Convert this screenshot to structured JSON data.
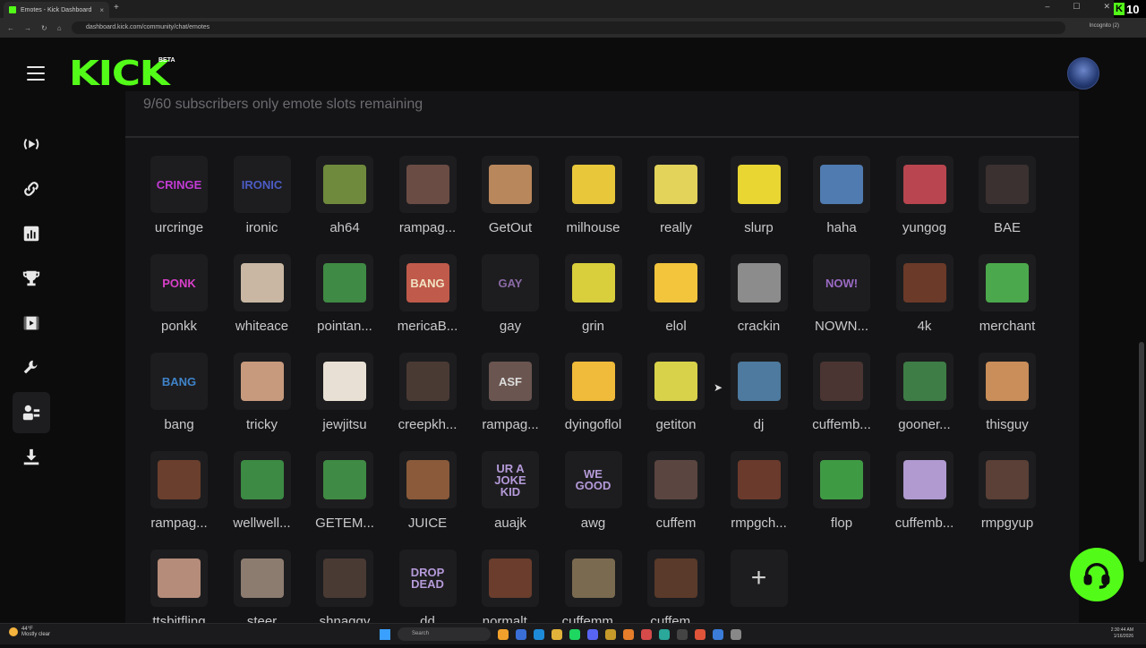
{
  "browser": {
    "tab_title": "Emotes - Kick Dashboard",
    "tab_close": "×",
    "new_tab": "+",
    "url": "dashboard.kick.com/community/chat/emotes",
    "incognito": "Incognito (2)",
    "window_controls": [
      "–",
      "☐",
      "✕"
    ],
    "overlay_badge": "10"
  },
  "header": {
    "logo": "KICK",
    "beta": "BETA"
  },
  "sidebar": {
    "items": [
      {
        "icon": "broadcast-icon"
      },
      {
        "icon": "link-icon"
      },
      {
        "icon": "analytics-icon"
      },
      {
        "icon": "trophy-icon"
      },
      {
        "icon": "video-icon"
      },
      {
        "icon": "wrench-icon"
      },
      {
        "icon": "community-icon",
        "active": true
      },
      {
        "icon": "download-icon"
      }
    ]
  },
  "panel": {
    "slots_text": "9/60 subscribers only emote slots remaining"
  },
  "emotes": [
    {
      "label": "urcringe",
      "text": "CRINGE",
      "bg": "#1d1d1f",
      "fg": "#c23bd4"
    },
    {
      "label": "ironic",
      "text": "IRONIC",
      "bg": "#1d1d1f",
      "fg": "#4c5cc4"
    },
    {
      "label": "ah64",
      "text": "",
      "bg": "#6f8a3c",
      "fg": "#fff"
    },
    {
      "label": "rampag...",
      "text": "",
      "bg": "#6b4c44",
      "fg": "#fff"
    },
    {
      "label": "GetOut",
      "text": "",
      "bg": "#b9875c",
      "fg": "#fff"
    },
    {
      "label": "milhouse",
      "text": "",
      "bg": "#e8c83a",
      "fg": "#333"
    },
    {
      "label": "really",
      "text": "",
      "bg": "#e3d35a",
      "fg": "#333"
    },
    {
      "label": "slurp",
      "text": "",
      "bg": "#e9d633",
      "fg": "#333"
    },
    {
      "label": "haha",
      "text": "",
      "bg": "#4f7bb0",
      "fg": "#fff"
    },
    {
      "label": "yungog",
      "text": "",
      "bg": "#b8454f",
      "fg": "#fff"
    },
    {
      "label": "BAE",
      "text": "",
      "bg": "#3b3130",
      "fg": "#fff"
    },
    {
      "label": "ponkk",
      "text": "PONK",
      "bg": "#1d1d1f",
      "fg": "#d93fc9"
    },
    {
      "label": "whiteace",
      "text": "",
      "bg": "#c9b7a3",
      "fg": "#fff"
    },
    {
      "label": "pointan...",
      "text": "",
      "bg": "#3f8a44",
      "fg": "#fff"
    },
    {
      "label": "mericaB...",
      "text": "BANG",
      "bg": "#c05a4a",
      "fg": "#f1e3c4"
    },
    {
      "label": "gay",
      "text": "GAY",
      "bg": "#1d1d1f",
      "fg": "#8a6aa6"
    },
    {
      "label": "grin",
      "text": "",
      "bg": "#d9cf3c",
      "fg": "#333"
    },
    {
      "label": "elol",
      "text": "",
      "bg": "#f2c53d",
      "fg": "#333"
    },
    {
      "label": "crackin",
      "text": "",
      "bg": "#8c8c8c",
      "fg": "#fff"
    },
    {
      "label": "NOWN...",
      "text": "NOW!",
      "bg": "#1d1d1f",
      "fg": "#9a6ac4"
    },
    {
      "label": "4k",
      "text": "",
      "bg": "#6b3a28",
      "fg": "#fff"
    },
    {
      "label": "merchant",
      "text": "",
      "bg": "#4ca84c",
      "fg": "#fff"
    },
    {
      "label": "bang",
      "text": "BANG",
      "bg": "#1d1d1f",
      "fg": "#3f83c9"
    },
    {
      "label": "tricky",
      "text": "",
      "bg": "#c79a7d",
      "fg": "#fff"
    },
    {
      "label": "jewjitsu",
      "text": "",
      "bg": "#e8e0d4",
      "fg": "#333"
    },
    {
      "label": "creepkh...",
      "text": "",
      "bg": "#4a3a34",
      "fg": "#fff"
    },
    {
      "label": "rampag...",
      "text": "ASF",
      "bg": "#6a5550",
      "fg": "#ddd"
    },
    {
      "label": "dyingoflol",
      "text": "",
      "bg": "#f0bb3a",
      "fg": "#333"
    },
    {
      "label": "getiton",
      "text": "",
      "bg": "#d8d24a",
      "fg": "#333"
    },
    {
      "label": "dj",
      "text": "",
      "bg": "#4d7a9e",
      "fg": "#fff"
    },
    {
      "label": "cuffemb...",
      "text": "",
      "bg": "#4a3532",
      "fg": "#fff"
    },
    {
      "label": "gooner...",
      "text": "",
      "bg": "#3e7d46",
      "fg": "#fff"
    },
    {
      "label": "thisguy",
      "text": "",
      "bg": "#c98e5a",
      "fg": "#fff"
    },
    {
      "label": "rampag...",
      "text": "",
      "bg": "#6a3f2d",
      "fg": "#fff"
    },
    {
      "label": "wellwell...",
      "text": "",
      "bg": "#3c8a44",
      "fg": "#fff"
    },
    {
      "label": "GETEM...",
      "text": "",
      "bg": "#3f8a44",
      "fg": "#fff"
    },
    {
      "label": "JUICE",
      "text": "",
      "bg": "#8a5a3a",
      "fg": "#fff"
    },
    {
      "label": "auajk",
      "text": "UR A JOKE KID",
      "bg": "#1d1d1f",
      "fg": "#b59ad9"
    },
    {
      "label": "awg",
      "text": "WE GOOD",
      "bg": "#1d1d1f",
      "fg": "#b59ad9"
    },
    {
      "label": "cuffem",
      "text": "",
      "bg": "#5a4540",
      "fg": "#fff"
    },
    {
      "label": "rmpgch...",
      "text": "",
      "bg": "#6a3a2c",
      "fg": "#fff"
    },
    {
      "label": "flop",
      "text": "",
      "bg": "#3f9a44",
      "fg": "#fff"
    },
    {
      "label": "cuffemb...",
      "text": "",
      "bg": "#b09ad0",
      "fg": "#333"
    },
    {
      "label": "rmpgyup",
      "text": "",
      "bg": "#5a4036",
      "fg": "#fff"
    },
    {
      "label": "ttsbitfling",
      "text": "",
      "bg": "#b58c7a",
      "fg": "#fff"
    },
    {
      "label": "steer",
      "text": "",
      "bg": "#8c7c70",
      "fg": "#fff"
    },
    {
      "label": "shnaggy",
      "text": "",
      "bg": "#4a3a34",
      "fg": "#fff"
    },
    {
      "label": "dd",
      "text": "DROP DEAD",
      "bg": "#1d1d1f",
      "fg": "#b59ad9"
    },
    {
      "label": "normalt...",
      "text": "",
      "bg": "#6a3d2d",
      "fg": "#fff"
    },
    {
      "label": "cuffemm...",
      "text": "",
      "bg": "#7a6a50",
      "fg": "#fff"
    },
    {
      "label": "cuffem...",
      "text": "",
      "bg": "#5a3a2a",
      "fg": "#fff"
    },
    {
      "label": "",
      "text": "+",
      "bg": "transparent",
      "fg": "#d0d0d0",
      "add": true
    }
  ],
  "taskbar": {
    "weather_temp": "44°F",
    "weather_desc": "Mostly clear",
    "search": "Search",
    "time": "2:30:44 AM",
    "date": "1/16/2026"
  },
  "colors": {
    "accent": "#53fc18",
    "panel": "#141416",
    "page": "#0c0c0d"
  }
}
